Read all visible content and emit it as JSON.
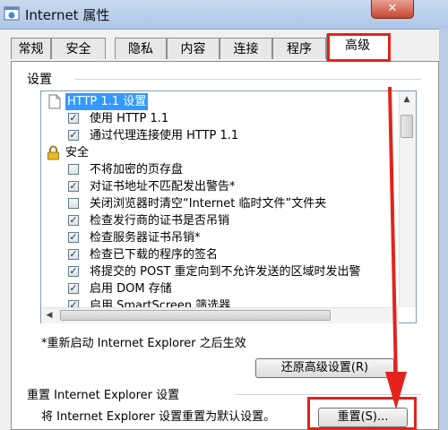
{
  "window": {
    "title": "Internet 属性",
    "close_label": "✕"
  },
  "tabs": [
    {
      "label": "常规",
      "active": false
    },
    {
      "label": "安全",
      "active": false
    },
    {
      "label": "隐私",
      "active": false
    },
    {
      "label": "内容",
      "active": false
    },
    {
      "label": "连接",
      "active": false
    },
    {
      "label": "程序",
      "active": false
    },
    {
      "label": "高级",
      "active": true
    }
  ],
  "settings": {
    "group_label": "设置",
    "items": [
      {
        "type": "header",
        "icon": "page-icon",
        "label": "HTTP 1.1 设置",
        "selected": true
      },
      {
        "type": "checkbox",
        "checked": true,
        "label": "使用 HTTP 1.1"
      },
      {
        "type": "checkbox",
        "checked": true,
        "label": "通过代理连接使用 HTTP 1.1"
      },
      {
        "type": "header",
        "icon": "lock-icon",
        "label": "安全",
        "selected": false
      },
      {
        "type": "checkbox",
        "checked": false,
        "label": "不将加密的页存盘"
      },
      {
        "type": "checkbox",
        "checked": true,
        "label": "对证书地址不匹配发出警告*"
      },
      {
        "type": "checkbox",
        "checked": false,
        "label": "关闭浏览器时清空“Internet 临时文件”文件夹"
      },
      {
        "type": "checkbox",
        "checked": true,
        "label": "检查发行商的证书是否吊销"
      },
      {
        "type": "checkbox",
        "checked": true,
        "label": "检查服务器证书吊销*"
      },
      {
        "type": "checkbox",
        "checked": true,
        "label": "检查已下载的程序的签名"
      },
      {
        "type": "checkbox",
        "checked": true,
        "label": "将提交的 POST 重定向到不允许发送的区域时发出警"
      },
      {
        "type": "checkbox",
        "checked": true,
        "label": "启用 DOM 存储"
      },
      {
        "type": "checkbox",
        "checked": true,
        "label": "启用 SmartScreen 筛选器"
      }
    ],
    "restart_note": "*重新启动 Internet Explorer 之后生效",
    "restore_button": "还原高级设置(R)"
  },
  "reset": {
    "group_label": "重置 Internet Explorer 设置",
    "description": "将 Internet Explorer 设置重置为默认设置。",
    "button": "重置(S)..."
  },
  "annotation_color": "#e3231b"
}
